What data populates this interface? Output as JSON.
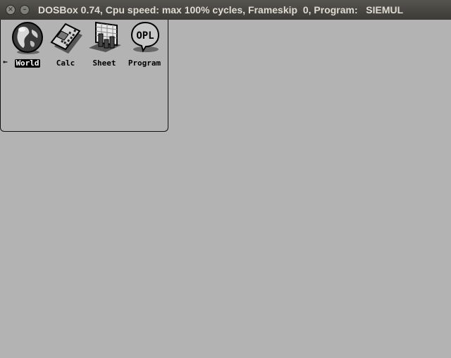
{
  "window": {
    "title": "DOSBox 0.74, Cpu speed: max 100% cycles, Frameskip  0, Program:   SIEMUL",
    "close_glyph": "×",
    "minimize_glyph": "–"
  },
  "launcher": {
    "selector_arrow": "←",
    "apps": [
      {
        "label": "World",
        "icon": "globe-icon",
        "selected": true
      },
      {
        "label": "Calc",
        "icon": "calculator-icon",
        "selected": false
      },
      {
        "label": "Sheet",
        "icon": "spreadsheet-icon",
        "selected": false
      },
      {
        "label": "Program",
        "icon": "opl-icon",
        "selected": false
      }
    ]
  },
  "colors": {
    "titlebar": "#3c3b37",
    "title_text": "#dfdbd2",
    "screen_bg": "#b3b3b3"
  }
}
